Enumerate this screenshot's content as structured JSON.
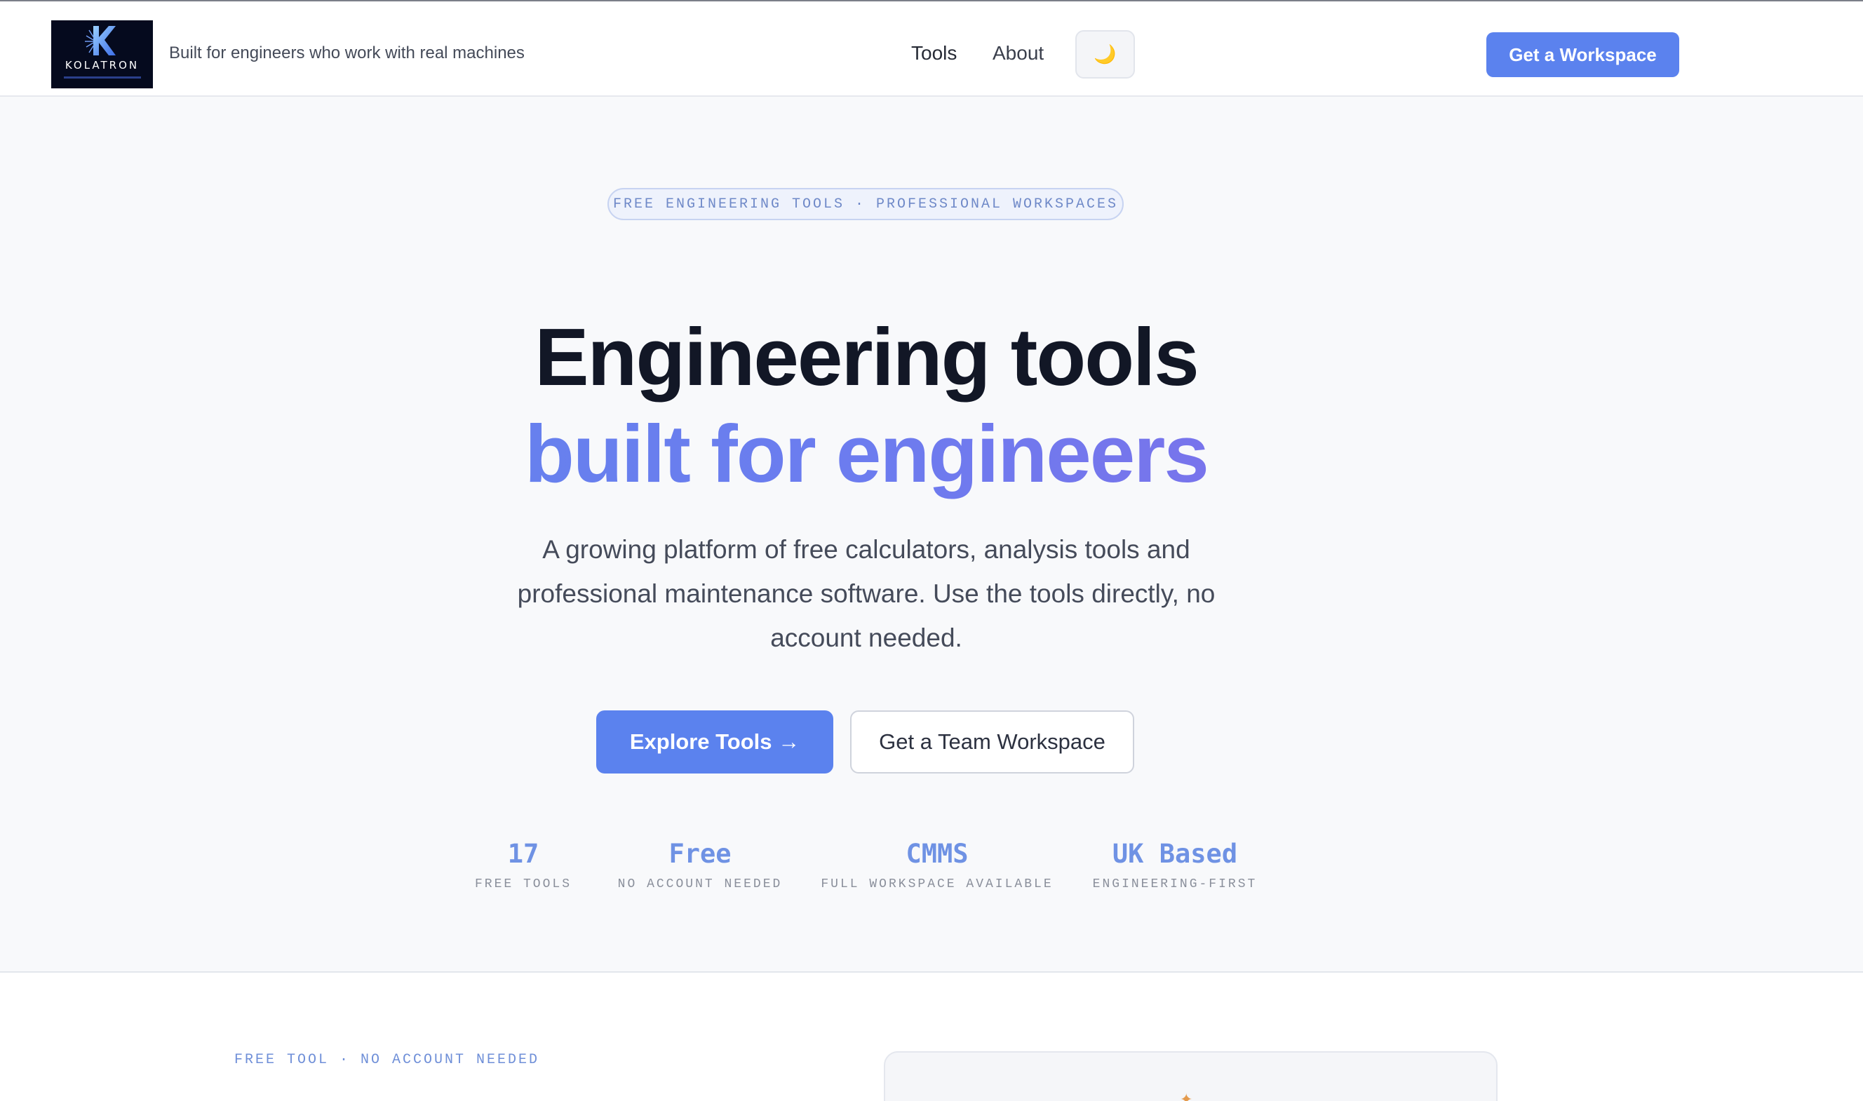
{
  "header": {
    "logo": {
      "wordmark": "KOLATRON",
      "icon": "kolatron-k-logo"
    },
    "tagline": "Built for engineers who work with real machines",
    "nav": [
      {
        "label": "Tools"
      },
      {
        "label": "About"
      }
    ],
    "theme_toggle": {
      "icon": "moon-icon",
      "glyph": "🌙"
    },
    "cta_label": "Get a Workspace"
  },
  "hero": {
    "pill": "FREE ENGINEERING TOOLS · PROFESSIONAL WORKSPACES",
    "title_line1": "Engineering tools",
    "title_line2": "built for engineers",
    "lede": "A growing platform of free calculators, analysis tools and professional maintenance software. Use the tools directly, no account needed.",
    "primary_button": "Explore Tools →",
    "secondary_button": "Get a Team Workspace"
  },
  "stats": [
    {
      "value": "17",
      "label": "FREE TOOLS"
    },
    {
      "value": "Free",
      "label": "NO ACCOUNT NEEDED"
    },
    {
      "value": "CMMS",
      "label": "FULL WORKSPACE AVAILABLE"
    },
    {
      "value": "UK Based",
      "label": "ENGINEERING-FIRST"
    }
  ],
  "section": {
    "eyebrow": "FREE TOOL · NO ACCOUNT NEEDED"
  },
  "colors": {
    "accent": "#5b82ee",
    "gradient_start": "#5f86ec",
    "gradient_end": "#8a68e6",
    "stat_value": "#6f92e4"
  }
}
